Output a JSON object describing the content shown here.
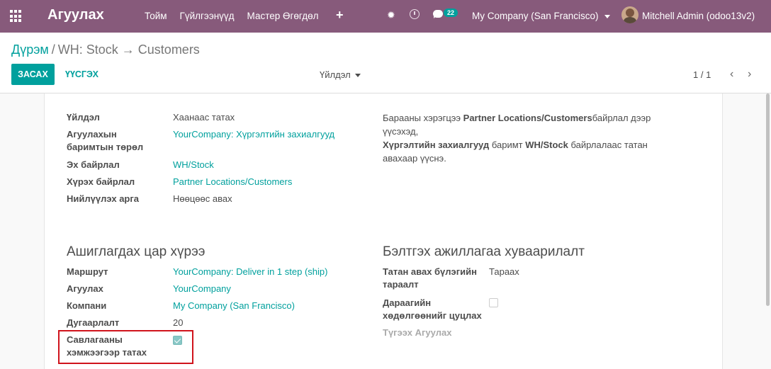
{
  "navbar": {
    "brand": "Агуулах",
    "menu": [
      "Тойм",
      "Гүйлгээнүүд",
      "Мастер Өгөгдөл"
    ],
    "message_count": "22",
    "company": "My Company (San Francisco)",
    "user": "Mitchell Admin (odoo13v2)"
  },
  "breadcrumb": {
    "root": "Дүрэм",
    "separator": "/",
    "current": "WH: Stock → Customers"
  },
  "buttons": {
    "edit": "ЗАСАХ",
    "create": "ҮҮСГЭХ",
    "action": "Үйлдэл"
  },
  "pager": {
    "value": "1 / 1"
  },
  "fields": {
    "action_label": "Үйлдэл",
    "action_value": "Хаанаас татах",
    "picking_type_label": "Агуулахын баримтын төрөл",
    "picking_type_value": "YourCompany: Хүргэлтийн захиалгууд",
    "src_location_label": "Эх байрлал",
    "src_location_value": "WH/Stock",
    "dest_location_label": "Хүрэх байрлал",
    "dest_location_value": "Partner Locations/Customers",
    "procure_method_label": "Нийлүүлэх арга",
    "procure_method_value": "Нөөцөөс авах"
  },
  "description": {
    "line1_pre": "Барааны хэрэгцээ ",
    "line1_bold": "Partner Locations/Customers",
    "line1_post": "байрлал дээр үүсэхэд,",
    "line2_bold1": "Хүргэлтийн захиалгууд",
    "line2_mid": " баримт ",
    "line2_bold2": "WH/Stock",
    "line2_post": " байрлалаас татан авахаар үүснэ."
  },
  "scope": {
    "title": "Ашиглагдах цар хүрээ",
    "route_label": "Маршрут",
    "route_value": "YourCompany: Deliver in 1 step (ship)",
    "warehouse_label": "Агуулах",
    "warehouse_value": "YourCompany",
    "company_label": "Компани",
    "company_value": "My Company (San Francisco)",
    "sequence_label": "Дугаарлалт",
    "sequence_value": "20",
    "propagate_label": "Савлагааны хэмжээгээр татах",
    "propagate_checked": true
  },
  "scheduling": {
    "title": "Бэлтгэх ажиллагаа хуваарилалт",
    "group_label": "Татан авах бүлэгийн тараалт",
    "group_value": "Тараах",
    "cancel_label": "Дараагийн хөдөлгөөнийг цуцлах",
    "cancel_checked": false,
    "warehouse_label": "Түгээх Агуулах"
  }
}
